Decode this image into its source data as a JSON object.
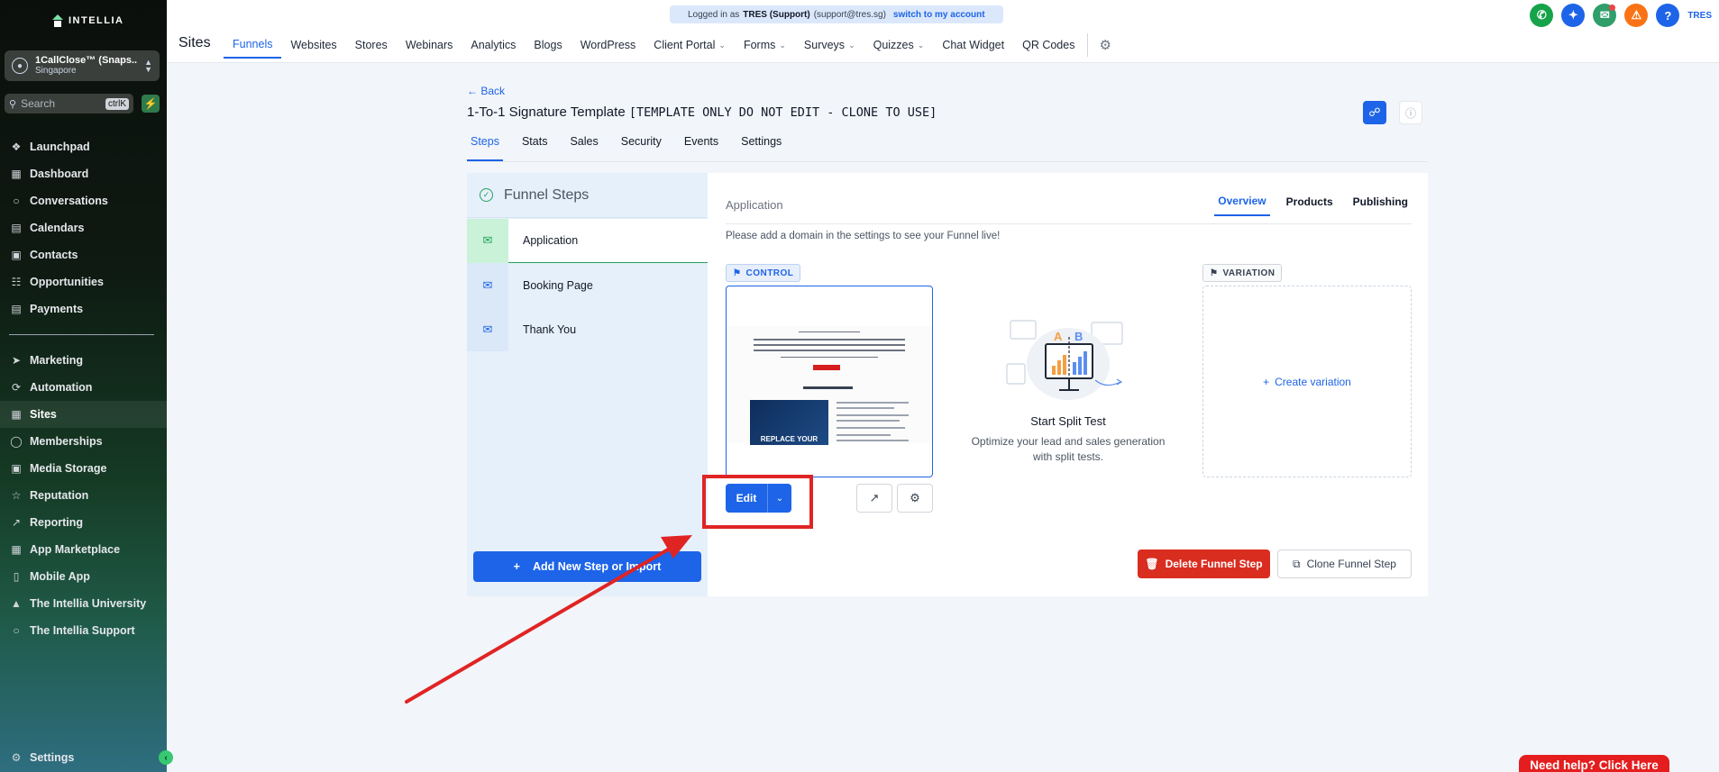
{
  "brand": {
    "name": "INTELLIA"
  },
  "account": {
    "name": "1CallClose™ (Snaps...",
    "location": "Singapore"
  },
  "search": {
    "placeholder": "Search",
    "shortcut": "ctrlK"
  },
  "sidebar": {
    "items_top": [
      {
        "label": "Launchpad",
        "icon": "launchpad-icon"
      },
      {
        "label": "Dashboard",
        "icon": "dashboard-icon"
      },
      {
        "label": "Conversations",
        "icon": "chat-icon"
      },
      {
        "label": "Calendars",
        "icon": "calendar-icon"
      },
      {
        "label": "Contacts",
        "icon": "contacts-icon"
      },
      {
        "label": "Opportunities",
        "icon": "opportunities-icon"
      },
      {
        "label": "Payments",
        "icon": "payments-icon"
      }
    ],
    "items_bottom": [
      {
        "label": "Marketing",
        "icon": "send-icon"
      },
      {
        "label": "Automation",
        "icon": "automation-icon"
      },
      {
        "label": "Sites",
        "icon": "sites-icon",
        "active": true
      },
      {
        "label": "Memberships",
        "icon": "memberships-icon"
      },
      {
        "label": "Media Storage",
        "icon": "media-icon"
      },
      {
        "label": "Reputation",
        "icon": "star-icon"
      },
      {
        "label": "Reporting",
        "icon": "chart-icon"
      },
      {
        "label": "App Marketplace",
        "icon": "grid-icon"
      },
      {
        "label": "Mobile App",
        "icon": "mobile-icon"
      },
      {
        "label": "The Intellia University",
        "icon": "graduation-icon"
      },
      {
        "label": "The Intellia Support",
        "icon": "support-icon"
      }
    ],
    "settings_label": "Settings"
  },
  "banner": {
    "prefix": "Logged in as",
    "user": "TRES (Support)",
    "email": "(support@tres.sg)",
    "link": "switch to my account"
  },
  "header": {
    "title": "Sites",
    "tabs": [
      {
        "label": "Funnels",
        "active": true
      },
      {
        "label": "Websites"
      },
      {
        "label": "Stores"
      },
      {
        "label": "Webinars"
      },
      {
        "label": "Analytics"
      },
      {
        "label": "Blogs"
      },
      {
        "label": "WordPress"
      },
      {
        "label": "Client Portal",
        "dropdown": true
      },
      {
        "label": "Forms",
        "dropdown": true
      },
      {
        "label": "Surveys",
        "dropdown": true
      },
      {
        "label": "Quizzes",
        "dropdown": true
      },
      {
        "label": "Chat Widget"
      },
      {
        "label": "QR Codes"
      }
    ],
    "user_initials": "TRES"
  },
  "funnel": {
    "back_label": "Back",
    "title_main": "1-To-1 Signature Template",
    "title_note": "[TEMPLATE ONLY DO NOT EDIT - CLONE TO USE]",
    "tabs": [
      "Steps",
      "Stats",
      "Sales",
      "Security",
      "Events",
      "Settings"
    ]
  },
  "steps": {
    "heading": "Funnel Steps",
    "items": [
      {
        "label": "Application",
        "active": true
      },
      {
        "label": "Booking Page"
      },
      {
        "label": "Thank You"
      }
    ],
    "add_button": "Add New Step or Import"
  },
  "detail": {
    "title": "Application",
    "tabs": [
      "Overview",
      "Products",
      "Publishing"
    ],
    "notice": "Please add a domain in the settings to see your Funnel live!",
    "control_tag": "CONTROL",
    "variation_tag": "VARIATION",
    "preview_image_text": "REPLACE YOUR",
    "edit_label": "Edit",
    "split_title": "Start Split Test",
    "split_desc_1": "Optimize your lead and sales generation",
    "split_desc_2": "with split tests.",
    "create_variation": "Create variation",
    "delete_label": "Delete Funnel Step",
    "clone_label": "Clone Funnel Step"
  },
  "help": {
    "label": "Need help? Click Here"
  },
  "colors": {
    "primary": "#1d64e8",
    "danger": "#d92d20",
    "success": "#22a15a",
    "annotation": "#e02424"
  }
}
